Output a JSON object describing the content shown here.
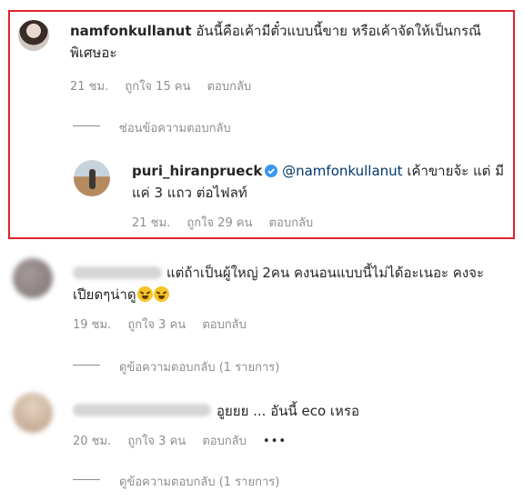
{
  "comments": [
    {
      "username": "namfonkullanut",
      "text_line1": "อันนี้คือเค้ามีตั๋วแบบนี้ขาย หรือเค้าจัดให้เป็นกรณี",
      "text_line2": "พิเศษอะ",
      "time": "21 ชม.",
      "likes": "ถูกใจ 15 คน",
      "reply": "ตอบกลับ",
      "toggle_replies": "ซ่อนข้อความตอบกลับ"
    }
  ],
  "reply": {
    "username": "puri_hiranprueck",
    "mention": "@namfonkullanut",
    "text_line1_rest": "เค้าขายจ้ะ แต่ มี",
    "text_line2": "แค่ 3 แถว ต่อไฟลท์",
    "time": "21 ชม.",
    "likes": "ถูกใจ 29 คน",
    "reply": "ตอบกลับ"
  },
  "comment2": {
    "text_line1": "แต่ถ้าเป็นผู้ใหญ่ 2คน คงนอนแบบนี้ไม่ได้อะเนอะ คงจะ",
    "text_line2": "เปียดๆน่าดู",
    "time": "19 ชม.",
    "likes": "ถูกใจ 3 คน",
    "reply": "ตอบกลับ",
    "view_replies": "ดูข้อความตอบกลับ (1 รายการ)"
  },
  "comment3": {
    "text": "อูยยย ... อันนี้ eco เหรอ",
    "time": "20 ชม.",
    "likes": "ถูกใจ 3 คน",
    "reply": "ตอบกลับ",
    "more": "•••",
    "view_replies": "ดูข้อความตอบกลับ (1 รายการ)"
  },
  "colors": {
    "highlight_border": "#e0212b",
    "verified_badge": "#3897f0",
    "mention": "#00376b",
    "meta_gray": "#8e8e8e"
  }
}
